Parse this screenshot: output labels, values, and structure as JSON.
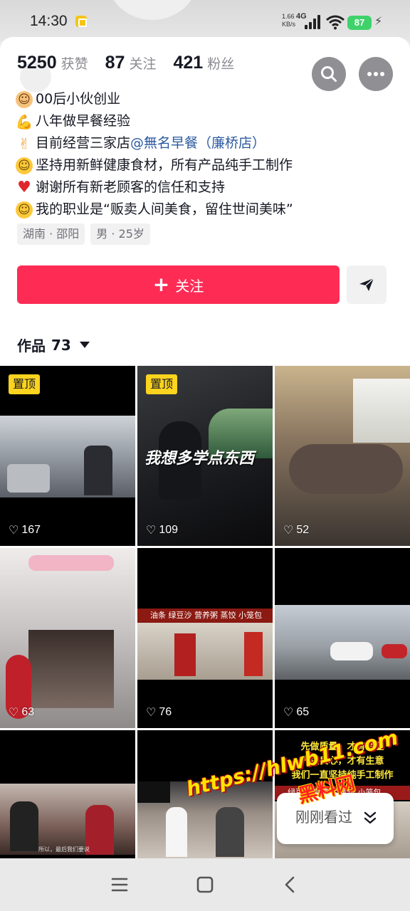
{
  "status": {
    "time": "14:30",
    "net_speed": "1.66",
    "net_unit": "KB/s",
    "net_type": "4G",
    "battery": "87"
  },
  "profile": {
    "stats": [
      {
        "value": "5250",
        "label": "获赞"
      },
      {
        "value": "87",
        "label": "关注"
      },
      {
        "value": "421",
        "label": "粉丝"
      }
    ],
    "bio": [
      {
        "emoji": "boy-face",
        "text": "00后小伙创业"
      },
      {
        "emoji": "flexed-biceps",
        "text": "八年做早餐经验"
      },
      {
        "emoji": "victory-hand",
        "text": "目前经营三家店",
        "mention": "@無名早餐（廉桥店）"
      },
      {
        "emoji": "slightly-smiling-face",
        "text": "坚持用新鲜健康食材，所有产品纯手工制作"
      },
      {
        "emoji": "red-heart",
        "text": "谢谢所有新老顾客的信任和支持"
      },
      {
        "emoji": "relieved-face",
        "text": "我的职业是“贩卖人间美食，留住世间美味”"
      }
    ],
    "tags": [
      "湖南 · 邵阳",
      "男 · 25岁"
    ],
    "follow_label": "关注",
    "accent_color": "#fe2c55"
  },
  "works": {
    "tab_label": "作品",
    "count": "73"
  },
  "videos": [
    {
      "pinned": "置顶",
      "likes": "167",
      "overlay": ""
    },
    {
      "pinned": "置顶",
      "likes": "109",
      "overlay": "我想多学点东西"
    },
    {
      "pinned": "",
      "likes": "52",
      "overlay": ""
    },
    {
      "pinned": "",
      "likes": "63",
      "overlay": ""
    },
    {
      "pinned": "",
      "likes": "76",
      "overlay": "",
      "banner": "油条 绿豆沙 营养粥 蒸饺 小笼包"
    },
    {
      "pinned": "",
      "likes": "65",
      "overlay": ""
    },
    {
      "pinned": "",
      "likes": "",
      "overlay": "",
      "subtitle": "所以，最后我们要说"
    },
    {
      "pinned": "",
      "likes": "",
      "overlay": ""
    },
    {
      "pinned": "",
      "likes": "",
      "overlay": "",
      "caption": [
        "先做质量，才有销量",
        "先做良心，才有生意",
        "我们一直坚持纯手工制作"
      ],
      "banner": "绿豆沙 营养粥 蒸饺 小笼包"
    }
  ],
  "collapse": {
    "label": "刚刚看过"
  },
  "watermark": {
    "url": "https://hlwb11.com",
    "name": "黑料网"
  }
}
